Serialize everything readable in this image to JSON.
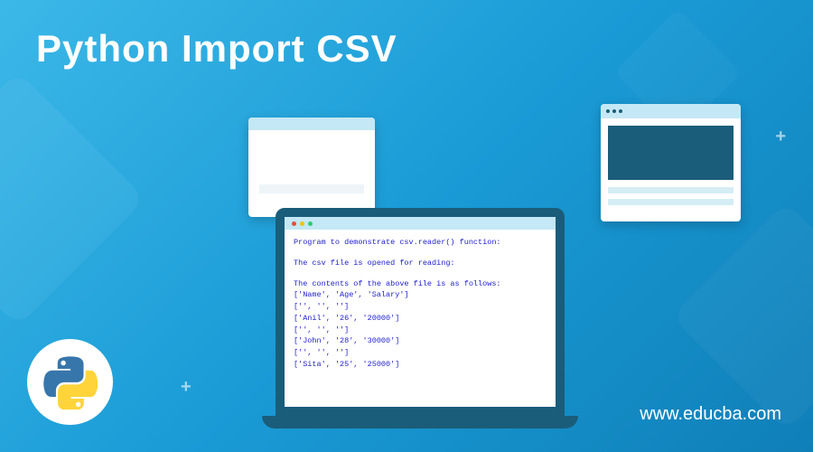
{
  "title": "Python Import CSV",
  "site_url": "www.educba.com",
  "code": {
    "header": "Program to demonstrate csv.reader() function:",
    "subheader": "The csv file is opened for reading:",
    "contents_label": "The contents of the above file is as follows:",
    "lines": [
      "['Name', 'Age', 'Salary']",
      "['', '', '']",
      "['Anil', '26', '20000']",
      "['', '', '']",
      "['John', '28', '30000']",
      "['', '', '']",
      "['Sita', '25', '25000']"
    ]
  },
  "icons": {
    "python": "python-logo",
    "plus": "+"
  }
}
